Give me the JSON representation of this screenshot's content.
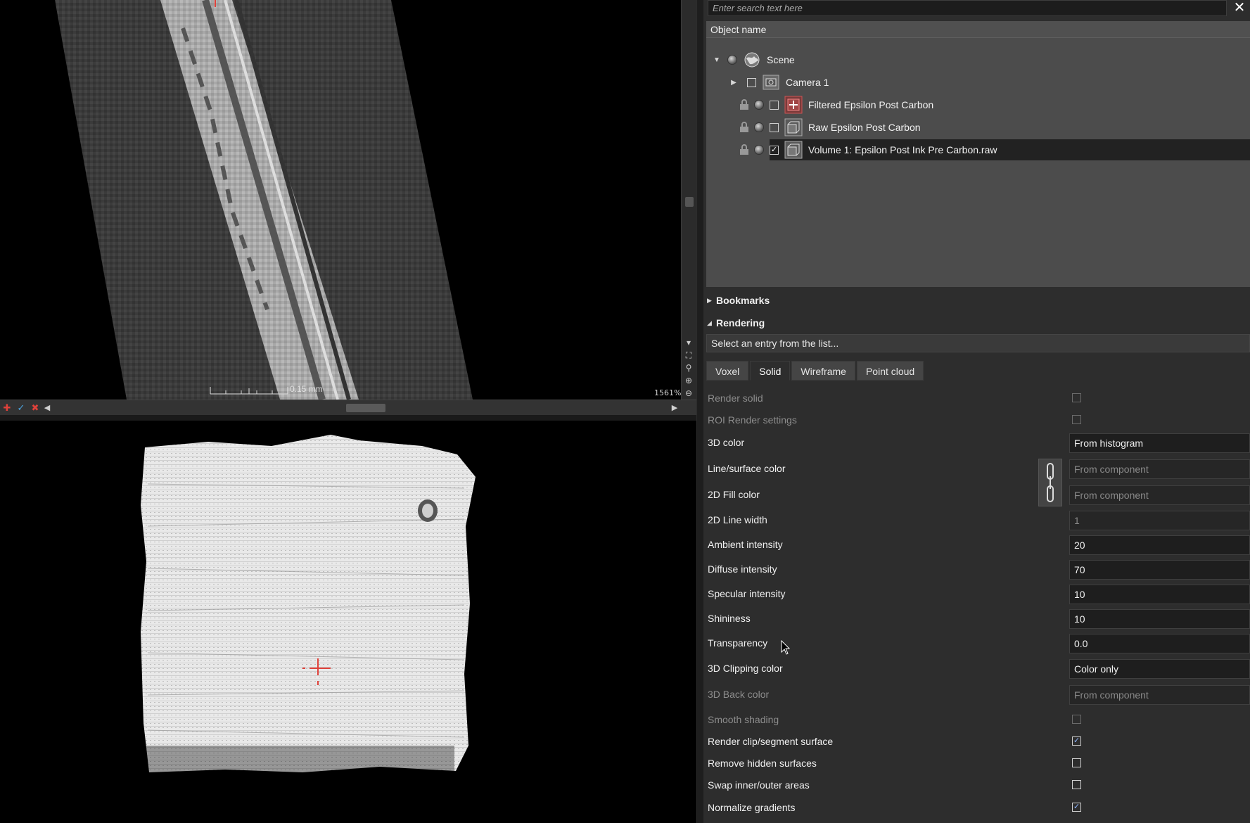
{
  "slice_view": {
    "scale_label": "0.15 mm",
    "zoom": "1561%"
  },
  "search": {
    "placeholder": "Enter search text here",
    "close_glyph": "✕"
  },
  "tree": {
    "header": "Object name",
    "items": [
      {
        "label": "Scene"
      },
      {
        "label": "Camera 1"
      },
      {
        "label": "Filtered Epsilon Post Carbon"
      },
      {
        "label": "Raw Epsilon Post Carbon"
      },
      {
        "label": "Volume 1: Epsilon Post Ink Pre Carbon.raw",
        "checked": true,
        "selected": true
      }
    ]
  },
  "sections": {
    "bookmarks": "Bookmarks",
    "rendering": "Rendering"
  },
  "preset": {
    "value": "Select an entry from the list..."
  },
  "tabs": [
    "Voxel",
    "Solid",
    "Wireframe",
    "Point cloud"
  ],
  "active_tab": "Solid",
  "properties": [
    {
      "label": "Render solid",
      "type": "checkbox",
      "checked": false,
      "enabled": false
    },
    {
      "label": "ROI Render settings",
      "type": "checkbox",
      "checked": false,
      "enabled": false
    },
    {
      "label": "3D color",
      "type": "field",
      "value": "From histogram",
      "enabled": true
    },
    {
      "label": "Line/surface color",
      "type": "field",
      "value": "From component",
      "enabled": false
    },
    {
      "label": "2D Fill color",
      "type": "field",
      "value": "From component",
      "enabled": false
    },
    {
      "label": "2D Line width",
      "type": "field",
      "value": "1",
      "enabled": false
    },
    {
      "label": "Ambient intensity",
      "type": "field",
      "value": "20",
      "enabled": true
    },
    {
      "label": "Diffuse intensity",
      "type": "field",
      "value": "70",
      "enabled": true
    },
    {
      "label": "Specular intensity",
      "type": "field",
      "value": "10",
      "enabled": true
    },
    {
      "label": "Shininess",
      "type": "field",
      "value": "10",
      "enabled": true
    },
    {
      "label": "Transparency",
      "type": "field",
      "value": "0.0",
      "enabled": true
    },
    {
      "label": "3D Clipping color",
      "type": "field",
      "value": "Color only",
      "enabled": true
    },
    {
      "label": "3D Back color",
      "type": "field",
      "value": "From component",
      "enabled": false
    },
    {
      "label": "Smooth shading",
      "type": "checkbox",
      "checked": false,
      "enabled": false
    },
    {
      "label": "Render clip/segment surface",
      "type": "checkbox",
      "checked": true,
      "enabled": true
    },
    {
      "label": "Remove hidden surfaces",
      "type": "checkbox",
      "checked": false,
      "enabled": true
    },
    {
      "label": "Swap inner/outer areas",
      "type": "checkbox",
      "checked": false,
      "enabled": true
    },
    {
      "label": "Normalize gradients",
      "type": "checkbox",
      "checked": true,
      "enabled": true
    }
  ],
  "colors": {
    "panel_bg": "#2d2d2d",
    "tree_bg": "#4c4c4c",
    "accent_red": "#e0413a",
    "check_blue": "#8fb4ff"
  }
}
